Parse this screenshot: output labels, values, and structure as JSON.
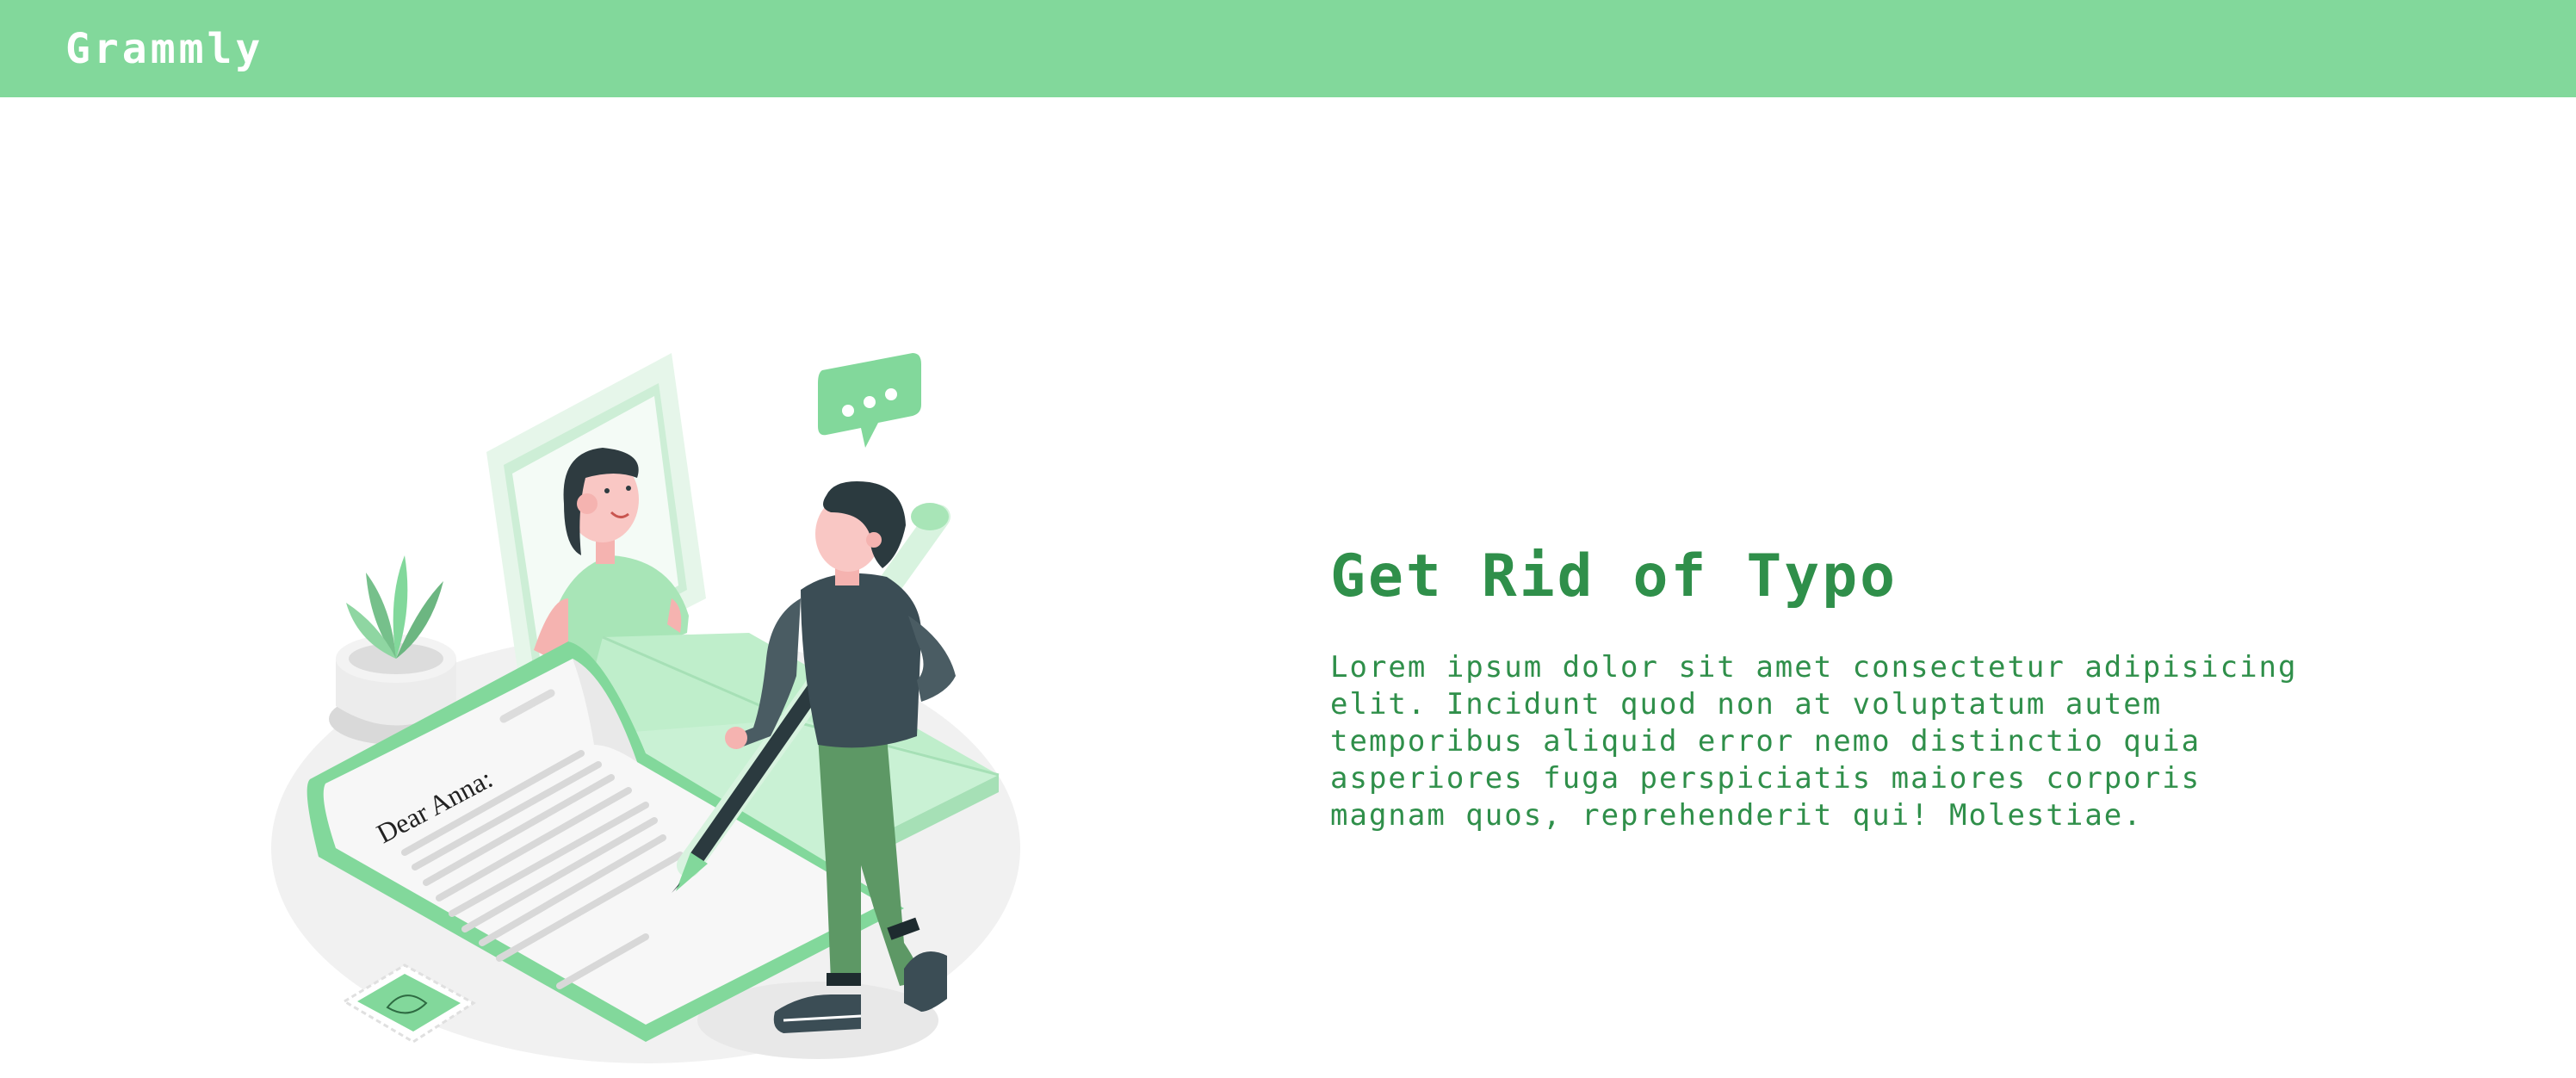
{
  "navbar": {
    "brand": "Grammly"
  },
  "hero": {
    "title": "Get Rid of Typo",
    "body": "Lorem ipsum dolor sit amet consectetur adipisicing elit. Incidunt quod non at voluptatum autem temporibus aliquid error nemo distinctio quia asperiores fuga perspiciatis maiores corporis magnam quos, reprehenderit qui! Molestiae.",
    "illustration": {
      "letter_text": "Dear Anna:",
      "icons": [
        "chat-bubble-icon",
        "plant-icon",
        "stamp-icon",
        "pencil-icon"
      ]
    }
  },
  "colors": {
    "accent": "#82d89b",
    "accent_text": "#2f8f4a",
    "brand_text": "#ffffff",
    "background": "#ffffff"
  }
}
